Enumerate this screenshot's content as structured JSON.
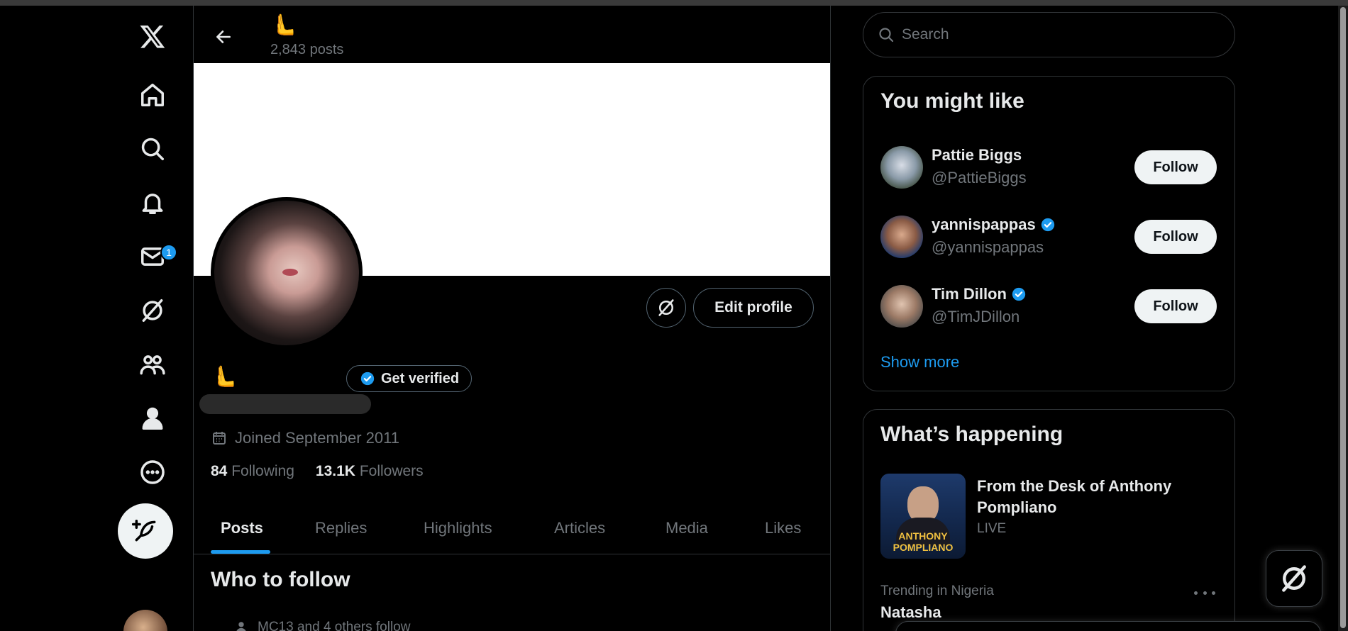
{
  "header": {
    "emoji": "🫷",
    "posts_count": "2,843 posts"
  },
  "nav": {
    "items": [
      "x-logo",
      "home-icon",
      "explore-icon",
      "notifications-icon",
      "messages-icon",
      "grok-icon",
      "communities-icon",
      "profile-icon",
      "more-icon"
    ],
    "messages_badge": "1"
  },
  "profile": {
    "display_emoji": "🫷",
    "get_verified_label": "Get verified",
    "edit_profile_label": "Edit profile",
    "joined": "Joined September 2011",
    "following_count": "84",
    "following_label": "Following",
    "followers_count": "13.1K",
    "followers_label": "Followers"
  },
  "tabs": [
    {
      "label": "Posts"
    },
    {
      "label": "Replies"
    },
    {
      "label": "Highlights"
    },
    {
      "label": "Articles"
    },
    {
      "label": "Media"
    },
    {
      "label": "Likes"
    }
  ],
  "who_to_follow": {
    "title": "Who to follow",
    "social_context": "MC13 and 4 others follow"
  },
  "search": {
    "placeholder": "Search"
  },
  "you_might_like": {
    "title": "You might like",
    "users": [
      {
        "name": "Pattie Biggs",
        "handle": "@PattieBiggs",
        "verified": false,
        "follow_label": "Follow"
      },
      {
        "name": "yannispappas",
        "handle": "@yannispappas",
        "verified": true,
        "follow_label": "Follow"
      },
      {
        "name": "Tim Dillon",
        "handle": "@TimJDillon",
        "verified": true,
        "follow_label": "Follow"
      }
    ],
    "show_more": "Show more"
  },
  "whats_happening": {
    "title": "What’s happening",
    "live_item": {
      "title": "From the Desk of Anthony Pompliano",
      "status": "LIVE",
      "image_text": "ANTHONY POMPLIANO"
    },
    "trend": {
      "meta": "Trending in Nigeria",
      "name": "Natasha"
    }
  },
  "colors": {
    "accent": "#1d9bf0",
    "background": "#000000",
    "text": "#e7e9ea",
    "muted": "#71767b"
  }
}
